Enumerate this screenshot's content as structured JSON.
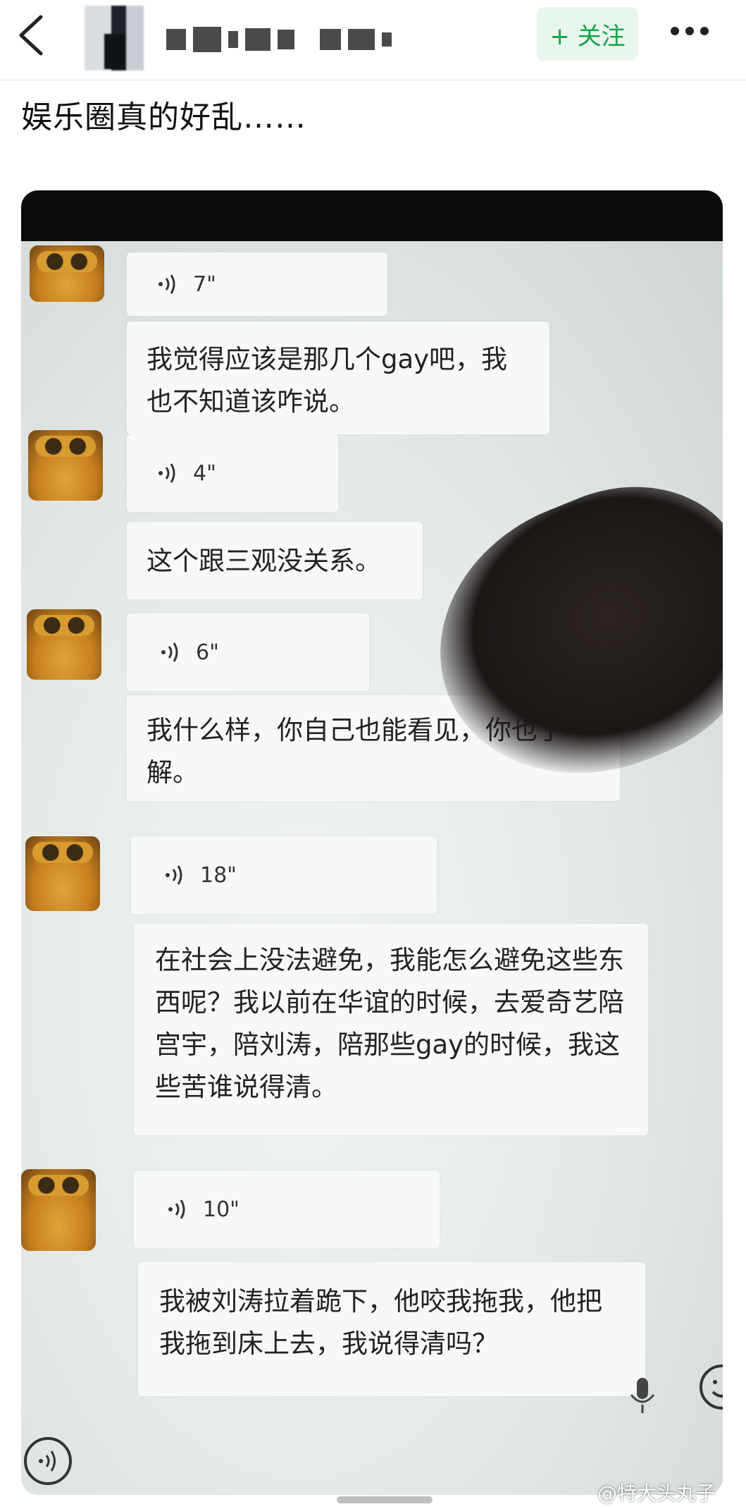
{
  "header": {
    "follow_label": "+ 关注"
  },
  "post": {
    "text": "娱乐圈真的好乱……"
  },
  "chat": [
    {
      "duration": "7\"",
      "message": "我觉得应该是那几个gay吧，我也不知道该咋说。"
    },
    {
      "duration": "4\"",
      "message": "这个跟三观没关系。"
    },
    {
      "duration": "6\"",
      "message": "我什么样，你自己也能看见，你也了解。"
    },
    {
      "duration": "18\"",
      "message": "在社会上没法避免，我能怎么避免这些东西呢？我以前在华谊的时候，去爱奇艺陪宫宇，陪刘涛，陪那些gay的时候，我这些苦谁说得清。"
    },
    {
      "duration": "10\"",
      "message": "我被刘涛拉着跪下，他咬我拖我，他把我拖到床上去，我说得清吗？"
    }
  ],
  "watermark": "@特大头丸子",
  "colors": {
    "follow_bg": "#e9f6ed",
    "follow_text": "#16a34a"
  }
}
